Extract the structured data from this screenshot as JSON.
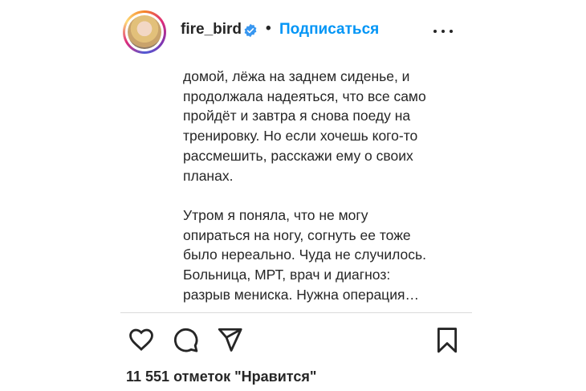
{
  "header": {
    "username": "fire_bird",
    "separator": "•",
    "follow_label": "Подписаться"
  },
  "caption": {
    "text": "домой, лёжа на заднем сиденье, и\nпродолжала надеяться, что все само\nпройдёт и завтра я снова поеду на\nтренировку. Но если хочешь кого-то\nрассмешить, расскажи ему о своих\nпланах.\n\nУтром я поняла, что не могу\nопираться на ногу, согнуть ее тоже\nбыло нереально. Чуда не случилось.\nБольница, МРТ, врач и диагноз:\nразрыв мениска. Нужна операция…"
  },
  "actions": {
    "icons": [
      "heart-icon",
      "comment-icon",
      "share-icon",
      "bookmark-icon"
    ]
  },
  "likes": {
    "label": "11 551 отметок \"Нравится\""
  },
  "colors": {
    "accent": "#0095f6",
    "text": "#262626",
    "divider": "#dbdbdb"
  }
}
